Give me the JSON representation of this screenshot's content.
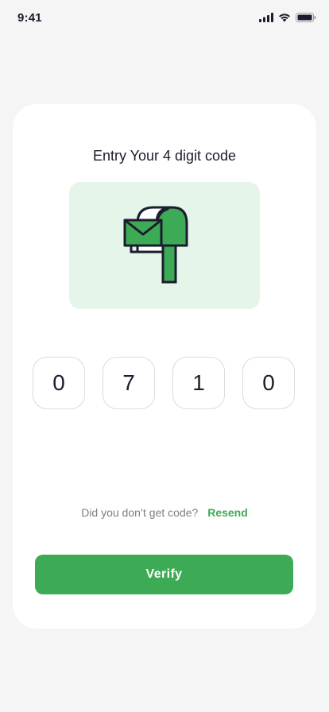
{
  "status_bar": {
    "time": "9:41",
    "icons": [
      "cellular-signal-icon",
      "wifi-icon",
      "battery-icon"
    ]
  },
  "card": {
    "title": "Entry Your 4 digit code",
    "illustration": "mailbox-with-envelope-icon",
    "code_digits": [
      "0",
      "7",
      "1",
      "0"
    ],
    "resend_prompt": "Did you don’t get code?",
    "resend_label": "Resend",
    "verify_label": "Verify"
  },
  "colors": {
    "background": "#f5f5f5",
    "card": "#ffffff",
    "accent": "#3daa55",
    "illustration_bg": "#e6f5ea",
    "text_dark": "#1c1c2e",
    "text_muted": "#7c7c86"
  }
}
